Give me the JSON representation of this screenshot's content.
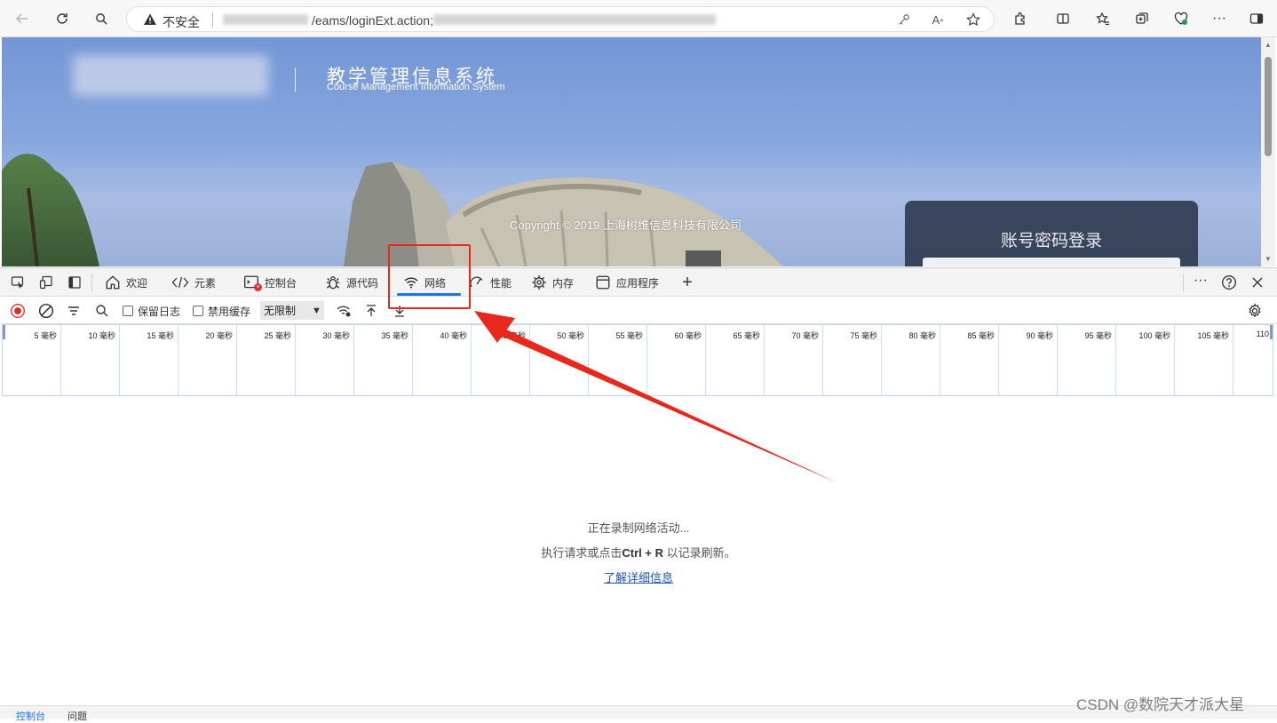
{
  "browser": {
    "security_label": "不安全",
    "url_visible": "/eams/loginExt.action;"
  },
  "page": {
    "system_title": "教学管理信息系统",
    "system_subtitle": "Course Management Information System",
    "copyright": "Copyright © 2019 上海树维信息科技有限公司",
    "login_title": "账号密码登录"
  },
  "devtools": {
    "tabs": [
      {
        "label": "欢迎",
        "icon": "home-icon"
      },
      {
        "label": "元素",
        "icon": "code-icon"
      },
      {
        "label": "控制台",
        "icon": "console-icon"
      },
      {
        "label": "源代码",
        "icon": "bug-icon"
      },
      {
        "label": "网络",
        "icon": "wifi-icon",
        "active": true
      },
      {
        "label": "性能",
        "icon": "performance-icon"
      },
      {
        "label": "内存",
        "icon": "memory-icon"
      },
      {
        "label": "应用程序",
        "icon": "application-icon"
      }
    ],
    "network_toolbar": {
      "preserve_log": "保留日志",
      "disable_cache": "禁用缓存",
      "throttle": "无限制"
    },
    "timeline_ticks": [
      "5 毫秒",
      "10 毫秒",
      "15 毫秒",
      "20 毫秒",
      "25 毫秒",
      "30 毫秒",
      "35 毫秒",
      "40 毫秒",
      "45 毫秒",
      "50 毫秒",
      "55 毫秒",
      "60 毫秒",
      "65 毫秒",
      "70 毫秒",
      "75 毫秒",
      "80 毫秒",
      "85 毫秒",
      "90 毫秒",
      "95 毫秒",
      "100 毫秒",
      "105 毫秒",
      "110"
    ],
    "empty_state": {
      "line1": "正在录制网络活动...",
      "line2_prefix": "执行请求或点击",
      "line2_shortcut": "Ctrl + R",
      "line2_suffix": " 以记录刷新。",
      "link": "了解详细信息"
    },
    "drawer": {
      "console": "控制台",
      "issues": "问题"
    }
  },
  "watermark": "CSDN @数院天才派大星",
  "colors": {
    "accent": "#1a73e8",
    "annotation": "#e8281c"
  }
}
